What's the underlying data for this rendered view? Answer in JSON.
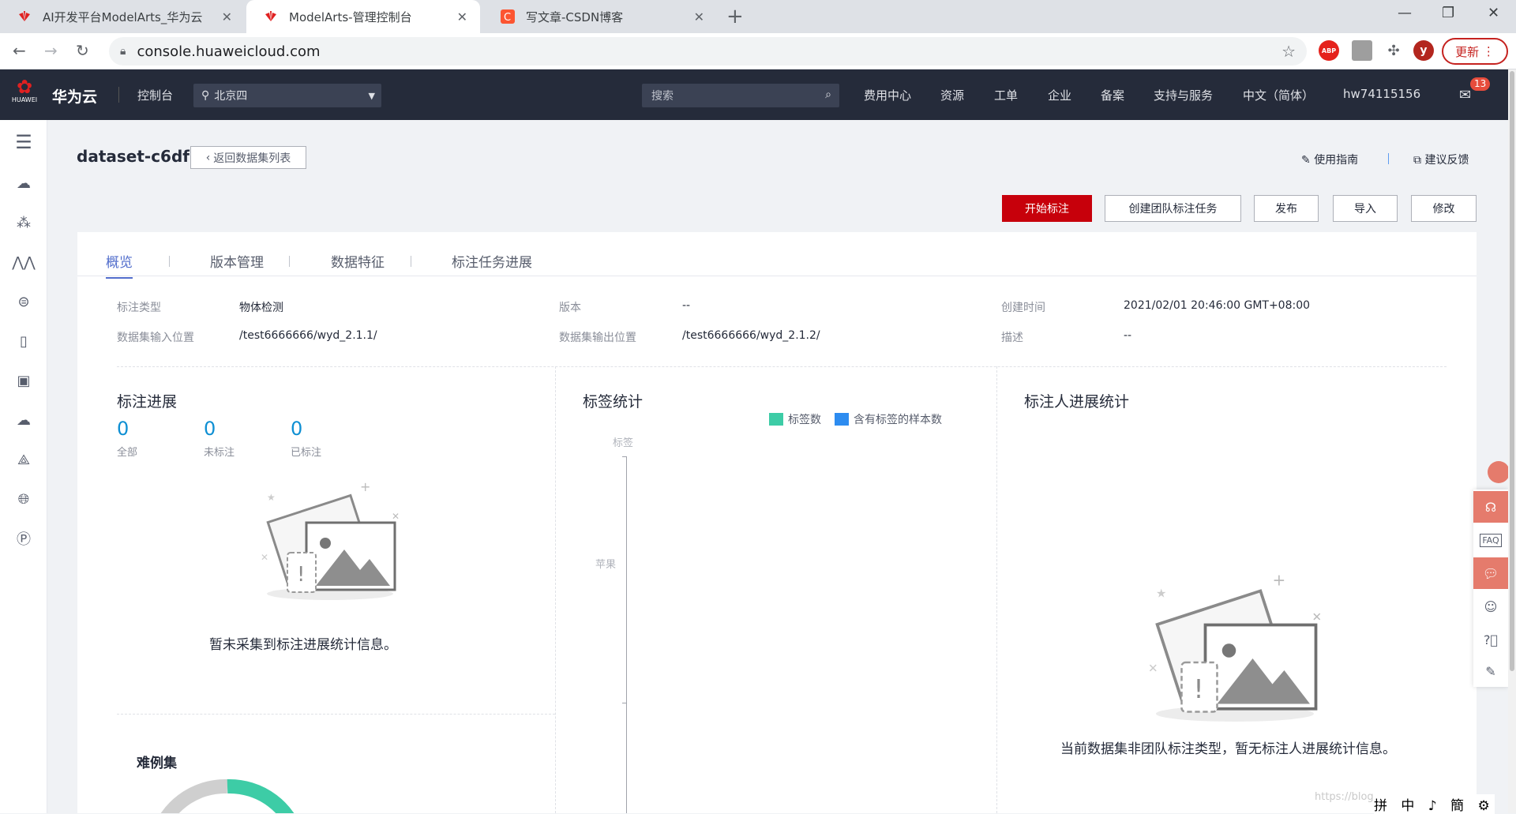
{
  "browser": {
    "tabs": [
      {
        "title": "AI开发平台ModelArts_华为云",
        "active": false
      },
      {
        "title": "ModelArts-管理控制台",
        "active": true
      },
      {
        "title": "写文章-CSDN博客",
        "active": false
      }
    ],
    "url": "console.huaweicloud.com",
    "update_label": "更新",
    "profile_initial": "y",
    "abp_label": "ABP"
  },
  "header": {
    "brand_word": "HUAWEI",
    "brand": "华为云",
    "console": "控制台",
    "region": "北京四",
    "search_placeholder": "搜索",
    "nav": [
      "费用中心",
      "资源",
      "工单",
      "企业",
      "备案",
      "支持与服务",
      "中文（简体）",
      "hw74115156"
    ],
    "mail_count": "13"
  },
  "page": {
    "title": "dataset-c6df",
    "back_label": "返回数据集列表",
    "guide": "使用指南",
    "feedback": "建议反馈",
    "actions": {
      "start": "开始标注",
      "team": "创建团队标注任务",
      "publish": "发布",
      "import": "导入",
      "edit": "修改"
    },
    "tabs": [
      "概览",
      "版本管理",
      "数据特征",
      "标注任务进展"
    ],
    "info": {
      "label_type_lbl": "标注类型",
      "label_type": "物体检测",
      "version_lbl": "版本",
      "version": "--",
      "created_lbl": "创建时间",
      "created": "2021/02/01 20:46:00 GMT+08:00",
      "input_lbl": "数据集输入位置",
      "input": "/test6666666/wyd_2.1.1/",
      "output_lbl": "数据集输出位置",
      "output": "/test6666666/wyd_2.1.2/",
      "desc_lbl": "描述",
      "desc": "--"
    },
    "progress": {
      "title": "标注进展",
      "stats": [
        {
          "value": "0",
          "label": "全部"
        },
        {
          "value": "0",
          "label": "未标注"
        },
        {
          "value": "0",
          "label": "已标注"
        }
      ],
      "empty": "暂未采集到标注进展统计信息。"
    },
    "tag_stats": {
      "title": "标签统计",
      "legend": [
        {
          "name": "标签数",
          "color": "#3dcca6"
        },
        {
          "name": "含有标签的样本数",
          "color": "#2d8cf0"
        }
      ],
      "axis_title": "标签",
      "category": "苹果"
    },
    "annotator": {
      "title": "标注人进展统计",
      "empty": "当前数据集非团队标注类型，暂无标注人进展统计信息。"
    },
    "hard": {
      "title": "难例集"
    }
  },
  "float": {
    "faq": "FAQ"
  },
  "ime": "拼 中 ♪ 簡 ⚙",
  "watermark": "https://blog"
}
